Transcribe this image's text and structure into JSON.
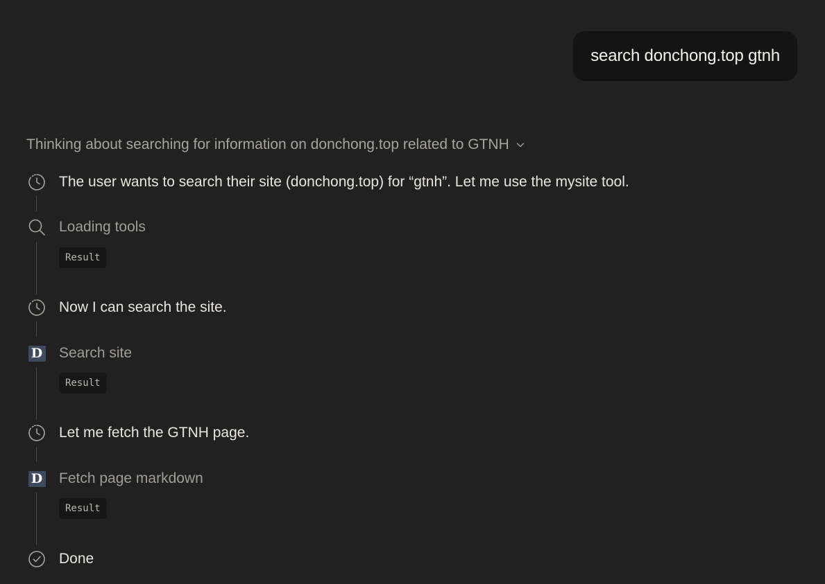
{
  "user_message": {
    "text": "search donchong.top gtnh"
  },
  "thinking": {
    "header": "Thinking about searching for information on donchong.top related to GTNH",
    "chevron_icon": "chevron-down-icon"
  },
  "steps": [
    {
      "kind": "thought",
      "icon": "clock-icon",
      "text": "The user wants to search their site (donchong.top) for “gtnh”. Let me use the mysite tool."
    },
    {
      "kind": "tool",
      "icon": "search-icon",
      "text": "Loading tools",
      "result_label": "Result"
    },
    {
      "kind": "thought",
      "icon": "clock-icon",
      "text": "Now I can search the site."
    },
    {
      "kind": "tool",
      "icon": "d-logo-icon",
      "icon_letter": "D",
      "text": "Search site",
      "result_label": "Result"
    },
    {
      "kind": "thought",
      "icon": "clock-icon",
      "text": "Let me fetch the GTNH page."
    },
    {
      "kind": "tool",
      "icon": "d-logo-icon",
      "icon_letter": "D",
      "text": "Fetch page markdown",
      "result_label": "Result"
    },
    {
      "kind": "done",
      "icon": "check-circle-icon",
      "text": "Done"
    }
  ],
  "colors": {
    "background": "#212121",
    "bubble": "#141414",
    "logo_bg": "#3f4a5e"
  }
}
